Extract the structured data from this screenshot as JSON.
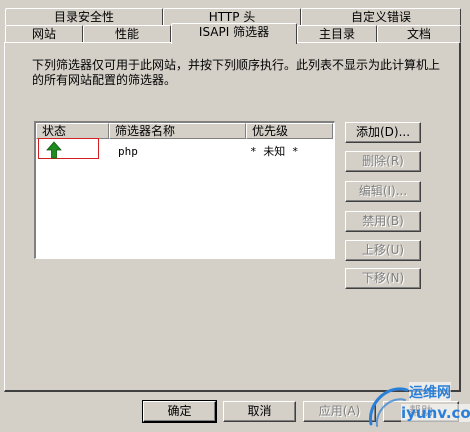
{
  "tabs_back_row": [
    {
      "label": "目录安全性"
    },
    {
      "label": "HTTP 头"
    },
    {
      "label": "自定义错误"
    }
  ],
  "tabs_front_row": [
    {
      "label": "网站"
    },
    {
      "label": "性能"
    },
    {
      "label": "ISAPI 筛选器",
      "active": true
    },
    {
      "label": "主目录"
    },
    {
      "label": "文档"
    }
  ],
  "description": "下列筛选器仅可用于此网站，并按下列顺序执行。此列表不显示为此计算机上的所有网站配置的筛选器。",
  "filter_list": {
    "columns": [
      "状态",
      "筛选器名称",
      "优先级"
    ],
    "rows": [
      {
        "status_icon": "green-up-arrow-icon",
        "name": "php",
        "priority": "* 未知 *"
      }
    ]
  },
  "side_buttons": {
    "add": "添加(D)...",
    "remove": "删除(R)",
    "edit": "编辑(I)...",
    "disable": "禁用(B)",
    "move_up": "上移(U)",
    "move_down": "下移(N)"
  },
  "bottom_buttons": {
    "ok": "确定",
    "cancel": "取消",
    "apply": "应用(A)",
    "help": "帮助"
  },
  "watermark": {
    "text_cn": "运维网",
    "text_en": "iyunv.com"
  },
  "colors": {
    "dialog_bg": "#d4d0c8",
    "status_highlight": "#d22020",
    "arrow": "#1f8a1f",
    "watermark": "#2a7fd8"
  }
}
